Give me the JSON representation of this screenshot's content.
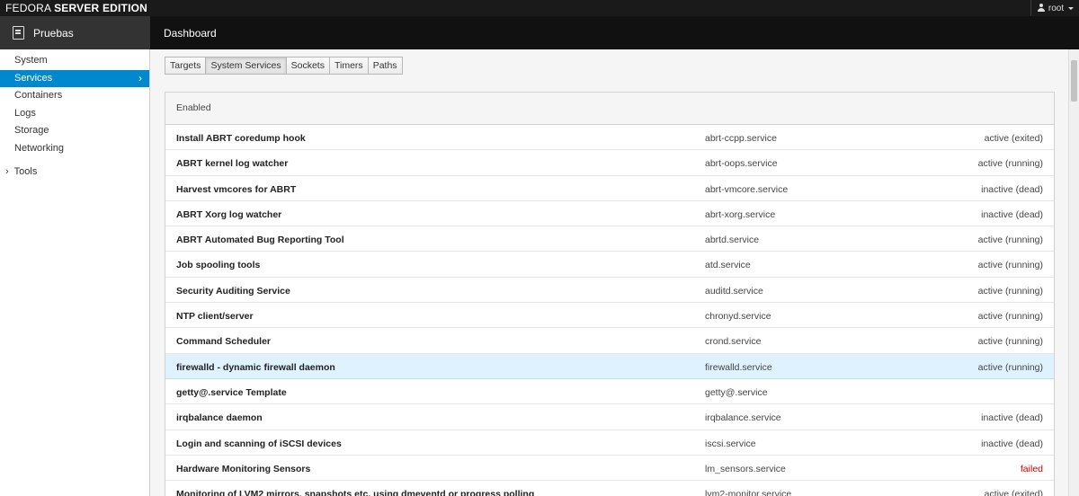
{
  "topbar": {
    "brand_light": "FEDORA",
    "brand_bold": "SERVER EDITION",
    "user": "root",
    "user_icon": "user-icon"
  },
  "host": {
    "name": "Pruebas",
    "icon": "server-icon"
  },
  "breadcrumb": {
    "title": "Dashboard"
  },
  "sidebar": {
    "items": [
      {
        "label": "System"
      },
      {
        "label": "Services",
        "active": true
      },
      {
        "label": "Containers"
      },
      {
        "label": "Logs"
      },
      {
        "label": "Storage"
      },
      {
        "label": "Networking"
      }
    ],
    "tools_label": "Tools",
    "active_color": "#0088ce"
  },
  "tabs": [
    {
      "label": "Targets"
    },
    {
      "label": "System Services",
      "active": true
    },
    {
      "label": "Sockets"
    },
    {
      "label": "Timers"
    },
    {
      "label": "Paths"
    }
  ],
  "services": {
    "header": "Enabled",
    "rows": [
      {
        "description": "Install ABRT coredump hook",
        "unit": "abrt-ccpp.service",
        "state": "active (exited)"
      },
      {
        "description": "ABRT kernel log watcher",
        "unit": "abrt-oops.service",
        "state": "active (running)"
      },
      {
        "description": "Harvest vmcores for ABRT",
        "unit": "abrt-vmcore.service",
        "state": "inactive (dead)"
      },
      {
        "description": "ABRT Xorg log watcher",
        "unit": "abrt-xorg.service",
        "state": "inactive (dead)"
      },
      {
        "description": "ABRT Automated Bug Reporting Tool",
        "unit": "abrtd.service",
        "state": "active (running)"
      },
      {
        "description": "Job spooling tools",
        "unit": "atd.service",
        "state": "active (running)"
      },
      {
        "description": "Security Auditing Service",
        "unit": "auditd.service",
        "state": "active (running)"
      },
      {
        "description": "NTP client/server",
        "unit": "chronyd.service",
        "state": "active (running)"
      },
      {
        "description": "Command Scheduler",
        "unit": "crond.service",
        "state": "active (running)"
      },
      {
        "description": "firewalld - dynamic firewall daemon",
        "unit": "firewalld.service",
        "state": "active (running)",
        "highlighted": true
      },
      {
        "description": "getty@.service Template",
        "unit": "getty@.service",
        "state": ""
      },
      {
        "description": "irqbalance daemon",
        "unit": "irqbalance.service",
        "state": "inactive (dead)"
      },
      {
        "description": "Login and scanning of iSCSI devices",
        "unit": "iscsi.service",
        "state": "inactive (dead)"
      },
      {
        "description": "Hardware Monitoring Sensors",
        "unit": "lm_sensors.service",
        "state": "failed",
        "failed": true
      },
      {
        "description": "Monitoring of LVM2 mirrors, snapshots etc. using dmeventd or progress polling",
        "unit": "lvm2-monitor.service",
        "state": "active (exited)"
      }
    ],
    "highlight_color": "#def3ff",
    "failed_color": "#cc0000"
  }
}
